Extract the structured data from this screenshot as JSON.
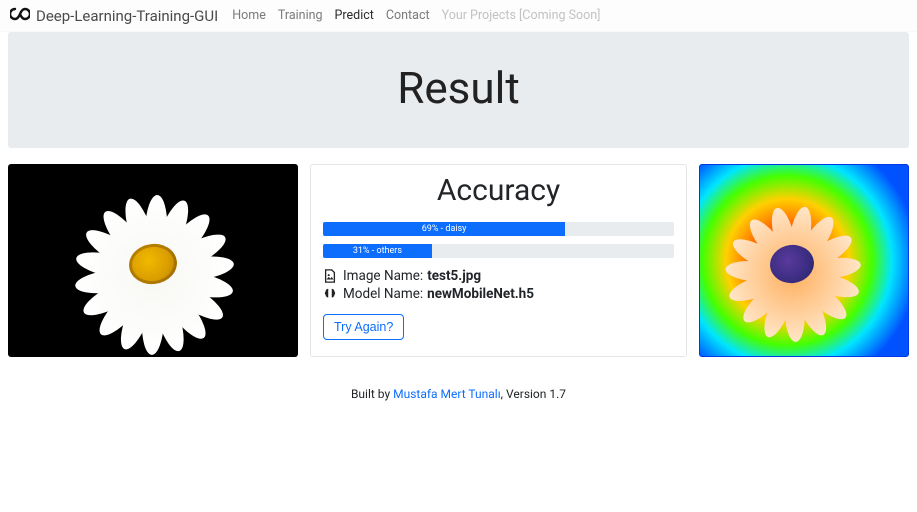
{
  "brand": "Deep-Learning-Training-GUI",
  "nav": {
    "home": "Home",
    "training": "Training",
    "predict": "Predict",
    "contact": "Contact",
    "projects": "Your Projects [Coming Soon]"
  },
  "jumbo": {
    "title": "Result"
  },
  "accuracy": {
    "title": "Accuracy",
    "bars": [
      {
        "percent": 69,
        "label": "69% - daisy"
      },
      {
        "percent": 31,
        "label": "31% - others"
      }
    ]
  },
  "info": {
    "image_label": "Image Name: ",
    "image_value": "test5.jpg",
    "model_label": "Model Name: ",
    "model_value": "newMobileNet.h5"
  },
  "try_again": "Try Again?",
  "footer": {
    "built_by": "Built by ",
    "author": "Mustafa Mert Tunalı",
    "version": ", Version 1.7"
  }
}
